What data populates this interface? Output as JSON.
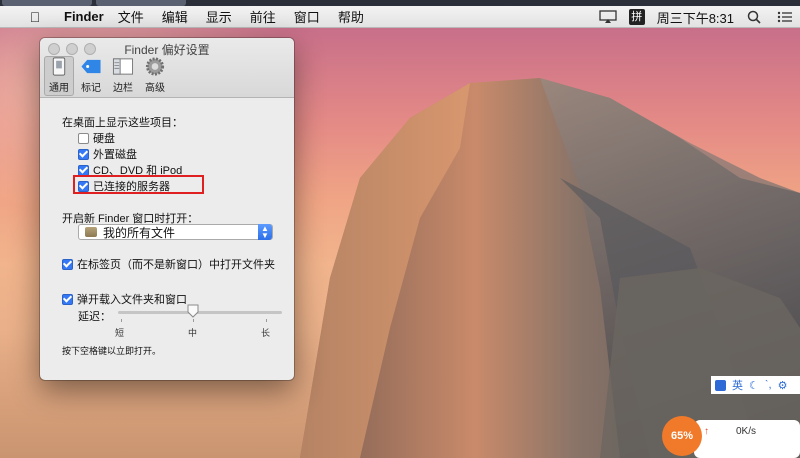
{
  "menubar": {
    "app_name": "Finder",
    "menus": [
      "文件",
      "编辑",
      "显示",
      "前往",
      "窗口",
      "帮助"
    ],
    "ime_indicator": "拼",
    "clock": "周三下午8:31"
  },
  "window": {
    "title": "Finder 偏好设置",
    "tabs": [
      {
        "label": "通用",
        "icon": "general-icon",
        "active": true
      },
      {
        "label": "标记",
        "icon": "tag-icon",
        "active": false
      },
      {
        "label": "边栏",
        "icon": "sidebar-icon",
        "active": false
      },
      {
        "label": "高级",
        "icon": "gear-icon",
        "active": false
      }
    ]
  },
  "general": {
    "desktop_heading": "在桌面上显示这些项目：",
    "desktop_items": [
      {
        "label": "硬盘",
        "checked": false
      },
      {
        "label": "外置磁盘",
        "checked": true
      },
      {
        "label": "CD、DVD 和 iPod",
        "checked": true
      },
      {
        "label": "已连接的服务器",
        "checked": true
      }
    ],
    "new_window_label": "开启新 Finder 窗口时打开：",
    "new_window_value": "我的所有文件",
    "open_in_tabs": {
      "label": "在标签页（而不是新窗口）中打开文件夹",
      "checked": true
    },
    "spring_loaded": {
      "label": "弹开载入文件夹和窗口",
      "checked": true
    },
    "delay_label": "延迟：",
    "slider": {
      "short": "短",
      "medium": "中",
      "long": "长",
      "value": 0.5
    },
    "footnote": "按下空格键以立即打开。"
  },
  "overlays": {
    "ime_lang": "英",
    "net_percent": "65%",
    "net_speed": "0K/s"
  }
}
